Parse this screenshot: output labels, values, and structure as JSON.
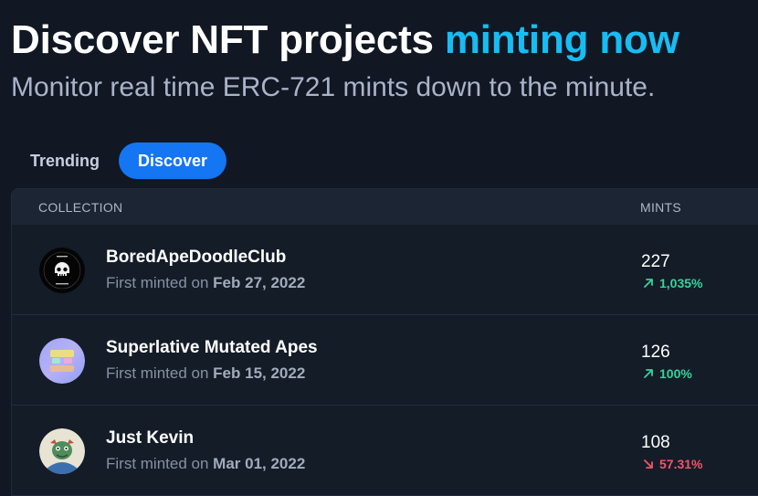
{
  "header": {
    "title_main": "Discover NFT projects",
    "title_accent": "minting now",
    "subtitle": "Monitor real time ERC-721 mints down to the minute."
  },
  "tabs": [
    {
      "label": "Trending",
      "active": false
    },
    {
      "label": "Discover",
      "active": true
    }
  ],
  "table": {
    "columns": {
      "collection": "COLLECTION",
      "mints": "MINTS"
    },
    "rows": [
      {
        "name": "BoredApeDoodleClub",
        "minted_prefix": "First minted on",
        "minted_date": "Feb 27, 2022",
        "mints": "227",
        "change": "1,035%",
        "direction": "up",
        "avatar_icon": "bored-ape-doodle-skull-avatar"
      },
      {
        "name": "Superlative Mutated Apes",
        "minted_prefix": "First minted on",
        "minted_date": "Feb 15, 2022",
        "mints": "126",
        "change": "100%",
        "direction": "up",
        "avatar_icon": "pastel-ape-avatar"
      },
      {
        "name": "Just Kevin",
        "minted_prefix": "First minted on",
        "minted_date": "Mar 01, 2022",
        "mints": "108",
        "change": "57.31%",
        "direction": "down",
        "avatar_icon": "kevin-character-avatar"
      }
    ]
  },
  "colors": {
    "background": "#111723",
    "accent": "#17bdf2",
    "tab_active": "#1476f2",
    "up": "#34d39a",
    "down": "#f0566a"
  }
}
